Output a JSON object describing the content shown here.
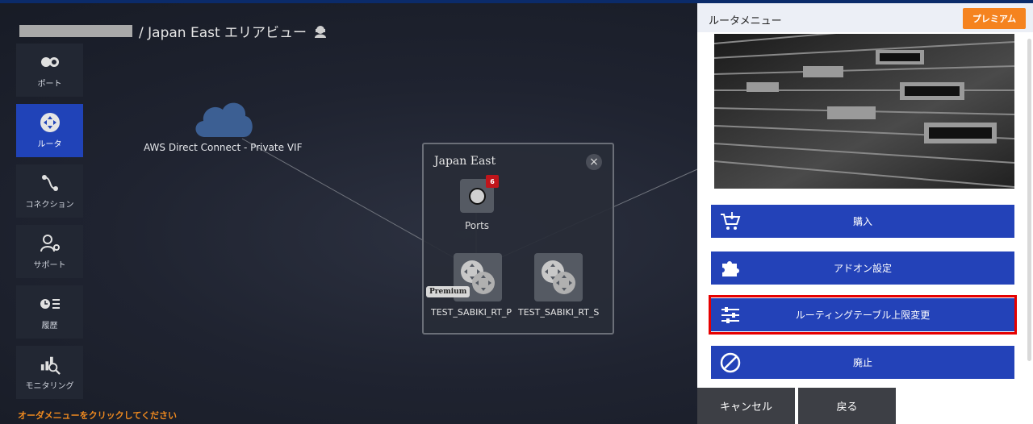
{
  "header": {
    "title": "/ Japan East エリアビュー"
  },
  "sidebar": {
    "items": [
      {
        "label": "ポート",
        "icon": "port-icon"
      },
      {
        "label": "ルータ",
        "icon": "router-icon"
      },
      {
        "label": "コネクション",
        "icon": "connection-icon"
      },
      {
        "label": "サポート",
        "icon": "support-icon"
      },
      {
        "label": "履歴",
        "icon": "history-icon"
      },
      {
        "label": "モニタリング",
        "icon": "monitoring-icon"
      }
    ],
    "active": "ルータ"
  },
  "instruction": "オーダメニューをクリックしてください",
  "map": {
    "cloud_label": "AWS Direct Connect - Private VIF",
    "region": {
      "title": "Japan East",
      "port_badge": "6",
      "ports_label": "Ports",
      "premium_tag": "Premium",
      "router1_label": "TEST_SABIKI_RT_P",
      "router2_label": "TEST_SABIKI_RT_S"
    }
  },
  "panel": {
    "title": "ルータメニュー",
    "premium_button": "プレミアム",
    "actions": [
      {
        "label": "購入",
        "icon": "cart-icon"
      },
      {
        "label": "アドオン設定",
        "icon": "puzzle-icon"
      },
      {
        "label": "ルーティングテーブル上限変更",
        "icon": "sliders-icon",
        "highlighted": true
      },
      {
        "label": "廃止",
        "icon": "prohibit-icon"
      }
    ],
    "cancel_label": "キャンセル",
    "back_label": "戻る"
  },
  "colors": {
    "accent_blue": "#2342b8",
    "premium_orange": "#f5831f",
    "highlight_red": "#e60000",
    "instruction_orange": "#f08a1f"
  }
}
